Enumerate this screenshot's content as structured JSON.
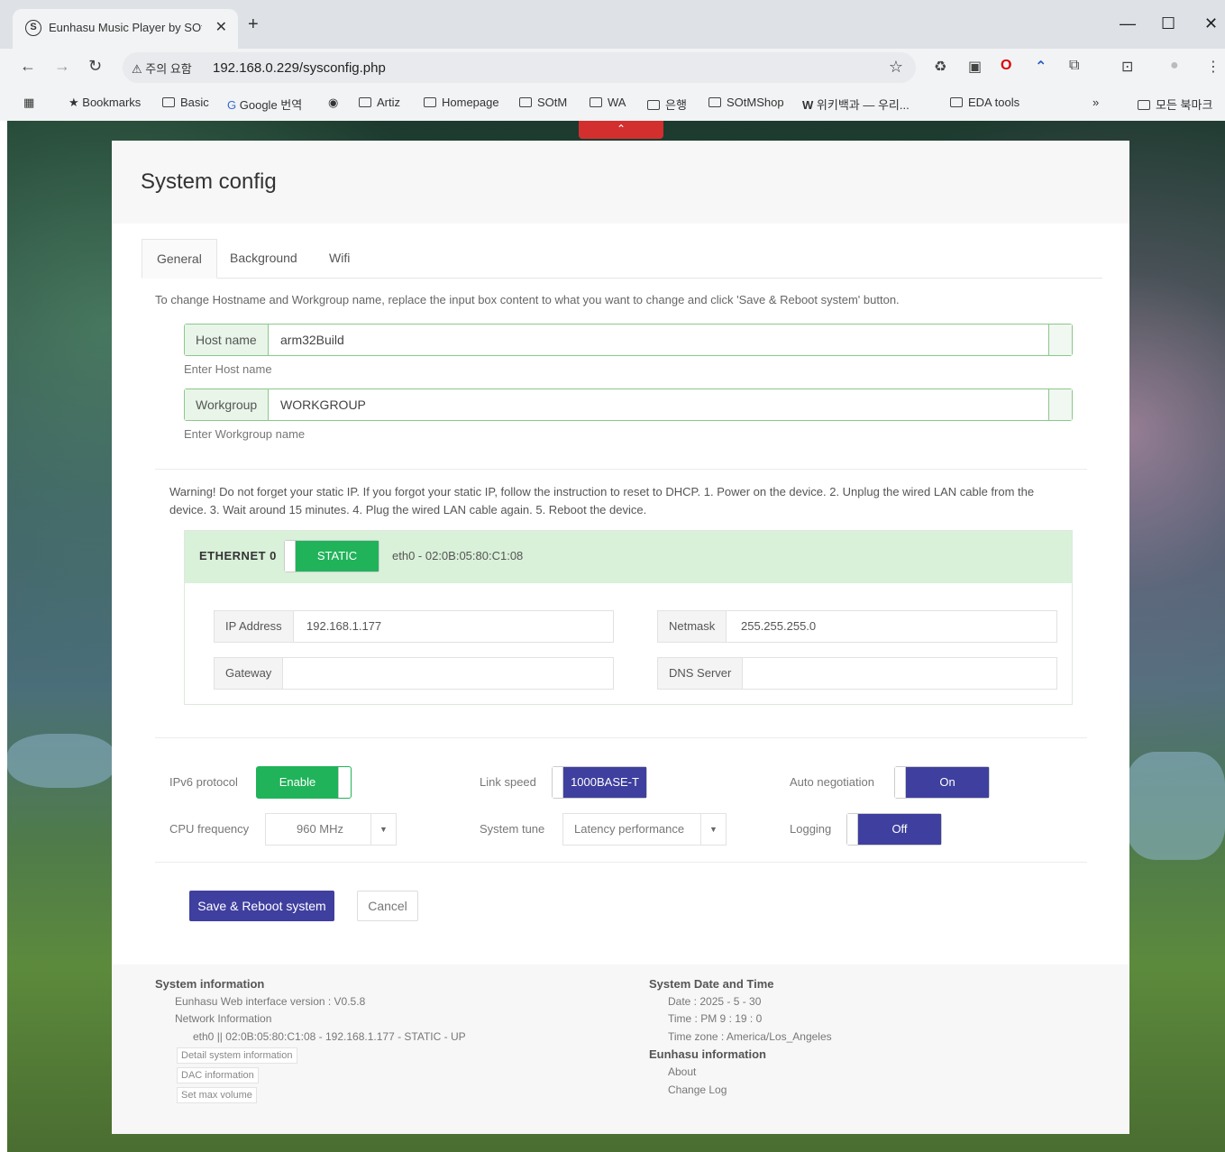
{
  "browser": {
    "tab_title": "Eunhasu Music Player by SOtM",
    "omnibox_warning": "주의 요함",
    "url": "192.168.0.229/sysconfig.php",
    "bookmarks": [
      "Bookmarks",
      "Basic",
      "Google 번역",
      "Artiz",
      "Homepage",
      "SOtM",
      "WA",
      "은행",
      "SOtMShop",
      "위키백과 — 우리...",
      "EDA tools"
    ],
    "all_bookmarks": "모든 북마크",
    "more": "»"
  },
  "modal": {
    "title": "System config",
    "tabs": [
      "General",
      "Background",
      "Wifi"
    ],
    "hint": "To change Hostname and Workgroup name, replace the input box content to what you want to change and click 'Save & Reboot system' button.",
    "hostname": {
      "label": "Host name",
      "value": "arm32Build",
      "help": "Enter Host name"
    },
    "workgroup": {
      "label": "Workgroup",
      "value": "WORKGROUP",
      "help": "Enter Workgroup name"
    },
    "warning": "Warning! Do not forget your static IP. If you forgot your static IP, follow the instruction to reset to DHCP. 1. Power on the device. 2. Unplug the wired LAN cable from the device. 3. Wait around 15 minutes. 4. Plug the wired LAN cable again. 5. Reboot the device.",
    "ethernet": {
      "label": "ETHERNET 0",
      "mode": "STATIC",
      "mac": "eth0 - 02:0B:05:80:C1:08",
      "ip": {
        "label": "IP Address",
        "value": "192.168.1.177"
      },
      "netmask": {
        "label": "Netmask",
        "value": "255.255.255.0"
      },
      "gateway": {
        "label": "Gateway",
        "value": ""
      },
      "dns": {
        "label": "DNS Server",
        "value": ""
      }
    },
    "options": {
      "ipv6": {
        "label": "IPv6 protocol",
        "value": "Enable"
      },
      "link": {
        "label": "Link speed",
        "value": "1000BASE-T"
      },
      "autoneg": {
        "label": "Auto negotiation",
        "value": "On"
      },
      "cpu": {
        "label": "CPU frequency",
        "value": "960 MHz"
      },
      "tune": {
        "label": "System tune",
        "value": "Latency performance"
      },
      "logging": {
        "label": "Logging",
        "value": "Off"
      }
    },
    "save_label": "Save & Reboot system",
    "cancel_label": "Cancel"
  },
  "footer": {
    "sys_title": "System information",
    "version": "Eunhasu Web interface version : V0.5.8",
    "net_title": "Network Information",
    "net_line": "eth0 || 02:0B:05:80:C1:08 - 192.168.1.177 - STATIC - UP",
    "btn_detail": "Detail system information",
    "btn_dac": "DAC information",
    "btn_vol": "Set max volume",
    "dt_title": "System Date and Time",
    "date": "Date : 2025 - 5 - 30",
    "time": "Time : PM 9 : 19 : 0",
    "tz": "Time zone : America/Los_Angeles",
    "eun_title": "Eunhasu information",
    "about": "About",
    "changelog": "Change Log"
  },
  "colors": {
    "green": "#21b35a",
    "indigo": "#3f3f9f",
    "eth_bg": "#d9f0d9",
    "input_border": "#8bc88b"
  },
  "icons": [
    "sotm-favicon",
    "close-icon",
    "plus-icon",
    "minimize-icon",
    "maximize-icon",
    "back-icon",
    "forward-icon",
    "reload-icon",
    "warning-icon",
    "star-icon",
    "apps-icon",
    "folder-icon",
    "chevron-up-icon",
    "caret-down-icon"
  ]
}
